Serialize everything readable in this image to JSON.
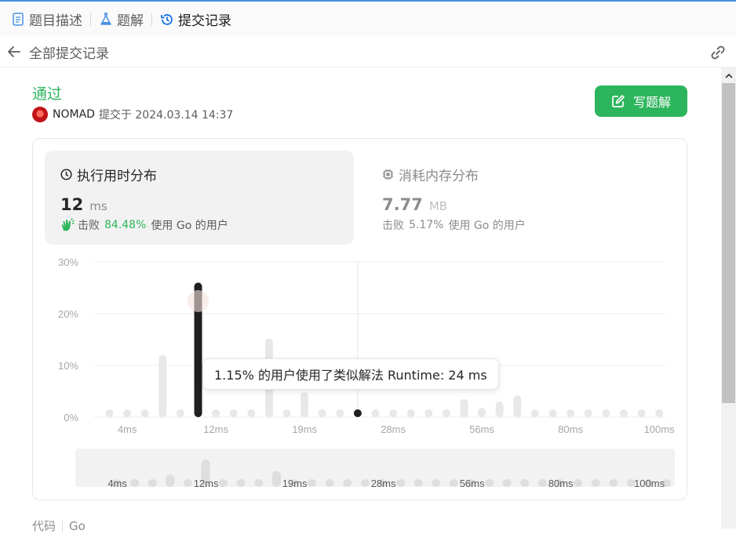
{
  "tabs": [
    {
      "label": "题目描述",
      "icon": "document-icon",
      "active": false
    },
    {
      "label": "题解",
      "icon": "flask-icon",
      "active": false
    },
    {
      "label": "提交记录",
      "icon": "history-icon",
      "active": true
    }
  ],
  "subheader": {
    "title": "全部提交记录",
    "back_icon": "arrow-left-icon",
    "link_icon": "link-icon"
  },
  "submission": {
    "status": "通过",
    "status_color": "#2db55d",
    "user": "NOMAD",
    "submitted_at": "提交于 2024.03.14 14:37",
    "write_solution_label": "写题解"
  },
  "runtime": {
    "title": "执行用时分布",
    "value": "12",
    "unit": "ms",
    "beat_prefix": "击败",
    "beat_pct": "84.48%",
    "beat_suffix": "使用 Go 的用户"
  },
  "memory": {
    "title": "消耗内存分布",
    "value": "7.77",
    "unit": "MB",
    "beat_prefix": "击败",
    "beat_pct": "5.17%",
    "beat_suffix": "使用 Go 的用户"
  },
  "tooltip": "1.15% 的用户使用了类似解法 Runtime: 24 ms",
  "code_section": {
    "label": "代码",
    "language": "Go"
  },
  "chart_data": {
    "type": "bar",
    "y_ticks": [
      "30%",
      "20%",
      "10%",
      "0%"
    ],
    "ylim": [
      0,
      30
    ],
    "x_tick_labels": [
      "4ms",
      "12ms",
      "19ms",
      "28ms",
      "56ms",
      "80ms",
      "100ms"
    ],
    "x_tick_bar_index": [
      1,
      6,
      11,
      16,
      21,
      26,
      31
    ],
    "values": [
      0.3,
      0.3,
      0.3,
      12,
      0.3,
      26,
      0.3,
      0.3,
      0.3,
      15.2,
      0.3,
      4.8,
      0.3,
      0.3,
      1.15,
      1.2,
      0.3,
      0.3,
      1.2,
      0.3,
      3.5,
      1.8,
      3,
      4.2,
      0.3,
      0.3,
      0.3,
      0.3,
      0.3,
      1.1,
      0.3,
      0.3
    ],
    "highlight_index": 5,
    "hover_index": 14,
    "overview_values": [
      0.3,
      0.3,
      0.3,
      2.5,
      0.3,
      5.5,
      0.3,
      0.3,
      0.3,
      3.2,
      0.3,
      0.3,
      0.3,
      0.3,
      0.3,
      0.3,
      0.3,
      0.3,
      0.3,
      0.3,
      0.3,
      0.3,
      0.3,
      0.3,
      0.3,
      0.3,
      0.3,
      0.3,
      0.3,
      0.3,
      0.3,
      0.3
    ],
    "colors": {
      "bar": "#e8e8e8",
      "highlight": "#1f1f1f",
      "grid": "#ececec",
      "tick": "#a6a6a6"
    }
  }
}
